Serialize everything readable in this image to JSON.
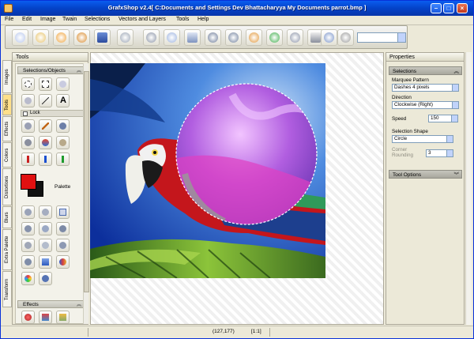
{
  "window": {
    "title": "GrafxShop v2.4[ C:Documents and Settings Dev Bhattacharyya My Documents parrot.bmp ]"
  },
  "menu": [
    "File",
    "Edit",
    "Image",
    "Twain",
    "Selections",
    "Vectors and Layers",
    "Tools",
    "Help"
  ],
  "toolbar": {
    "buttons": [
      "new-icon",
      "open-icon",
      "save-icon",
      "undo-history-icon",
      "disk-icon",
      "print-preview-icon",
      "cut-icon",
      "copy-icon",
      "paste-icon",
      "rotate-icon",
      "undo-icon",
      "redo-icon",
      "effect-icon",
      "brush-icon",
      "scanner-icon",
      "resize-icon",
      "cancel-icon"
    ],
    "combo_value": ""
  },
  "tools_panel": {
    "title": "Tools",
    "section_selections": "Selections/Objects",
    "lock_label": "Lock",
    "palette_label": "Palette",
    "section_effects": "Effects",
    "colors": {
      "foreground": "#e01010",
      "background": "#111111"
    }
  },
  "side_tabs": [
    "Images",
    "Tools",
    "Effects",
    "Colors",
    "Distortions",
    "Blurs",
    "Extra Palette",
    "Transform"
  ],
  "properties": {
    "title": "Properties",
    "selections_header": "Selections",
    "marquee_label": "Marquee Pattern",
    "marquee_value": "Dashes 4 pixels",
    "direction_label": "Direction",
    "direction_value": "Clockwise (Right)",
    "speed_label": "Speed",
    "speed_value": "150",
    "shape_label": "Selection Shape",
    "shape_value": "Circle",
    "corner_label": "Corner\nRounding",
    "corner_value": "3",
    "tool_options_header": "Tool Options"
  },
  "status": {
    "coords": "(127,177)",
    "zoom": "[1:1]"
  }
}
